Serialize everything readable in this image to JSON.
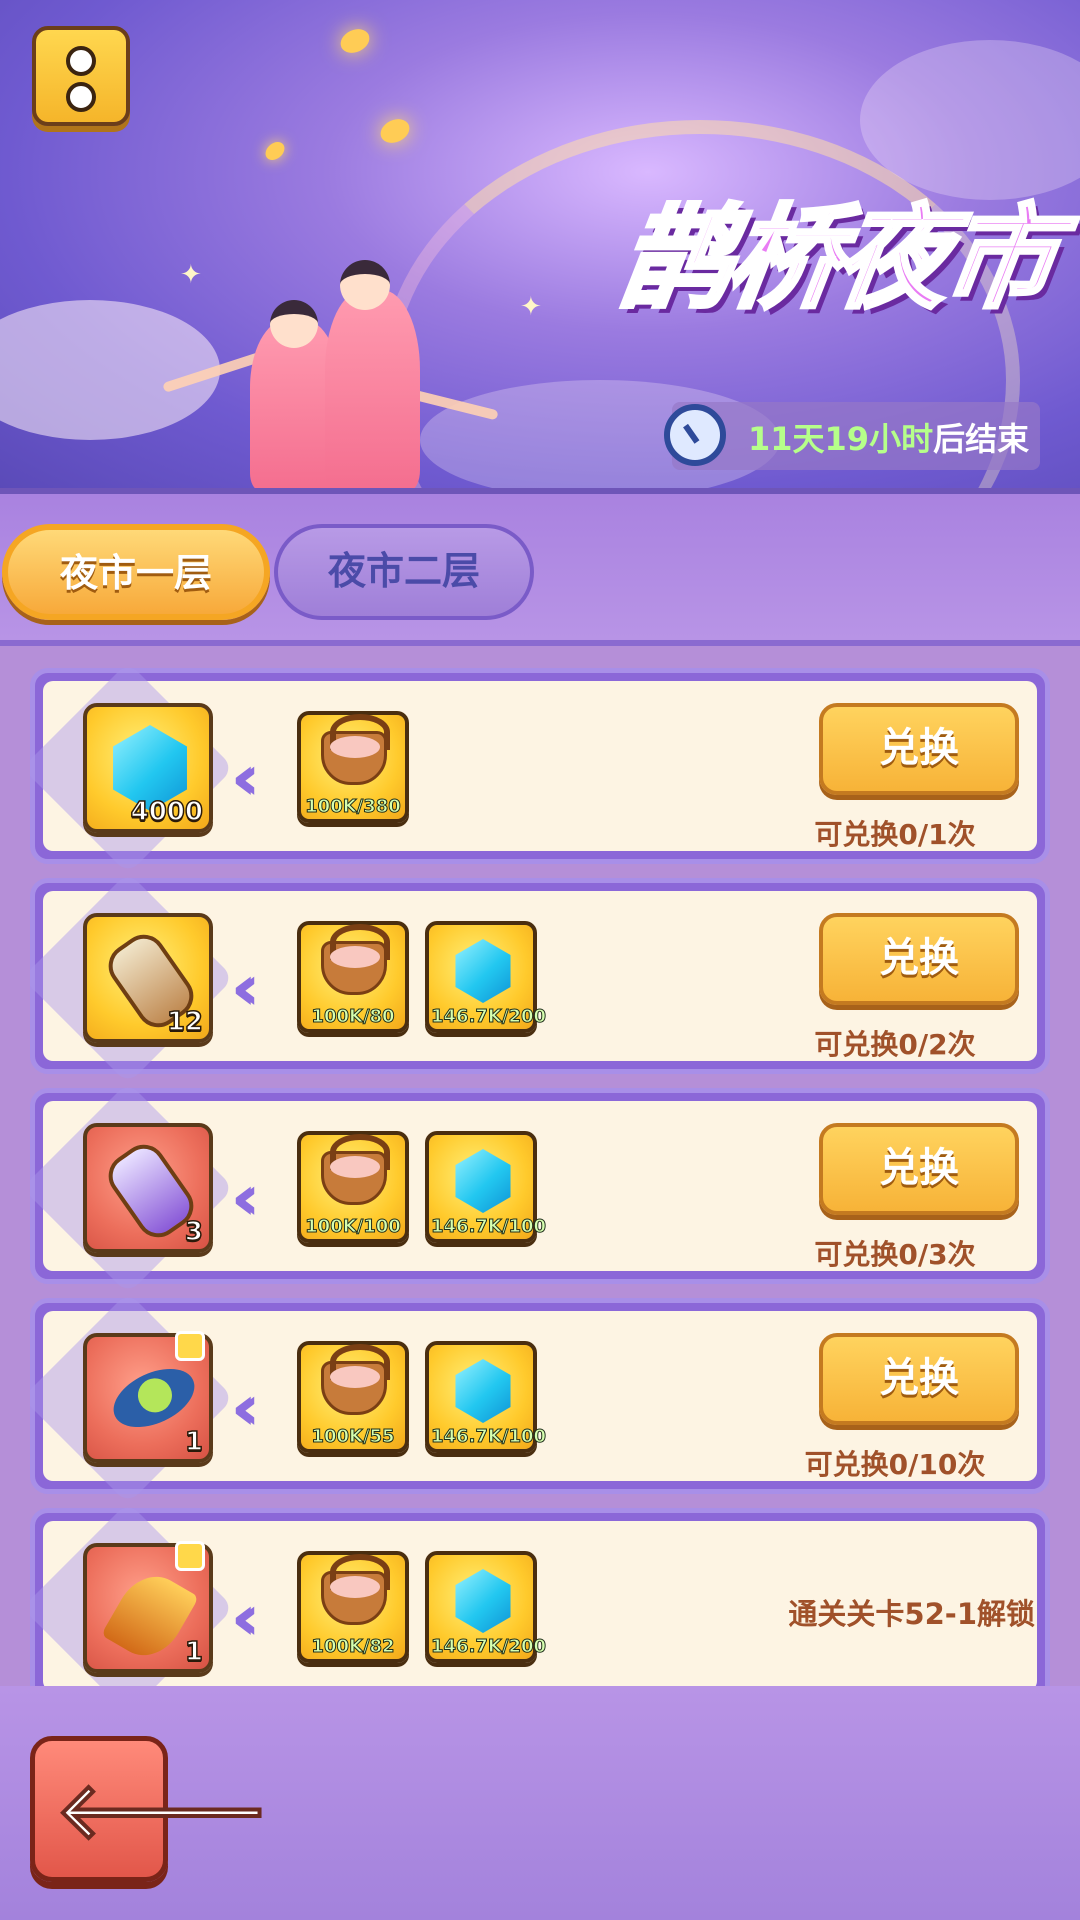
{
  "banner": {
    "title": "鹊桥夜市",
    "timer_value": "11天19小时",
    "timer_suffix": "后结束"
  },
  "tabs": [
    {
      "label": "夜市一层",
      "active": true
    },
    {
      "label": "夜市二层",
      "active": false
    }
  ],
  "exchange_items": [
    {
      "reward": "diamond",
      "reward_qty": "4000",
      "costs": [
        {
          "item": "basket",
          "label": "100K/380"
        }
      ],
      "button": "兑换",
      "limit": "可兑换0/1次"
    },
    {
      "reward": "scroll",
      "reward_qty": "12",
      "costs": [
        {
          "item": "basket",
          "label": "100K/80"
        },
        {
          "item": "diamond",
          "label": "146.7K/200"
        }
      ],
      "button": "兑换",
      "limit": "可兑换0/2次"
    },
    {
      "reward": "purple-scroll",
      "reward_qty": "3",
      "costs": [
        {
          "item": "basket",
          "label": "100K/100"
        },
        {
          "item": "diamond",
          "label": "146.7K/100"
        }
      ],
      "button": "兑换",
      "limit": "可兑换0/3次"
    },
    {
      "reward": "pea-pod-fragment",
      "reward_qty": "1",
      "costs": [
        {
          "item": "basket",
          "label": "100K/55"
        },
        {
          "item": "diamond",
          "label": "146.7K/100"
        }
      ],
      "button": "兑换",
      "limit": "可兑换0/10次"
    },
    {
      "reward": "leaf-fragment",
      "reward_qty": "1",
      "costs": [
        {
          "item": "basket",
          "label": "100K/82"
        },
        {
          "item": "diamond",
          "label": "146.7K/200"
        }
      ],
      "locked_text": "通关关卡52-1解锁"
    }
  ],
  "icons": {
    "menu": "menu-icon",
    "clock": "clock-icon",
    "back": "back-arrow-icon"
  },
  "colors": {
    "accent_gold": "#f7b338",
    "title_pink": "#e97cf4",
    "panel_purple": "#8b67d8",
    "text_brown": "#a0512a"
  }
}
